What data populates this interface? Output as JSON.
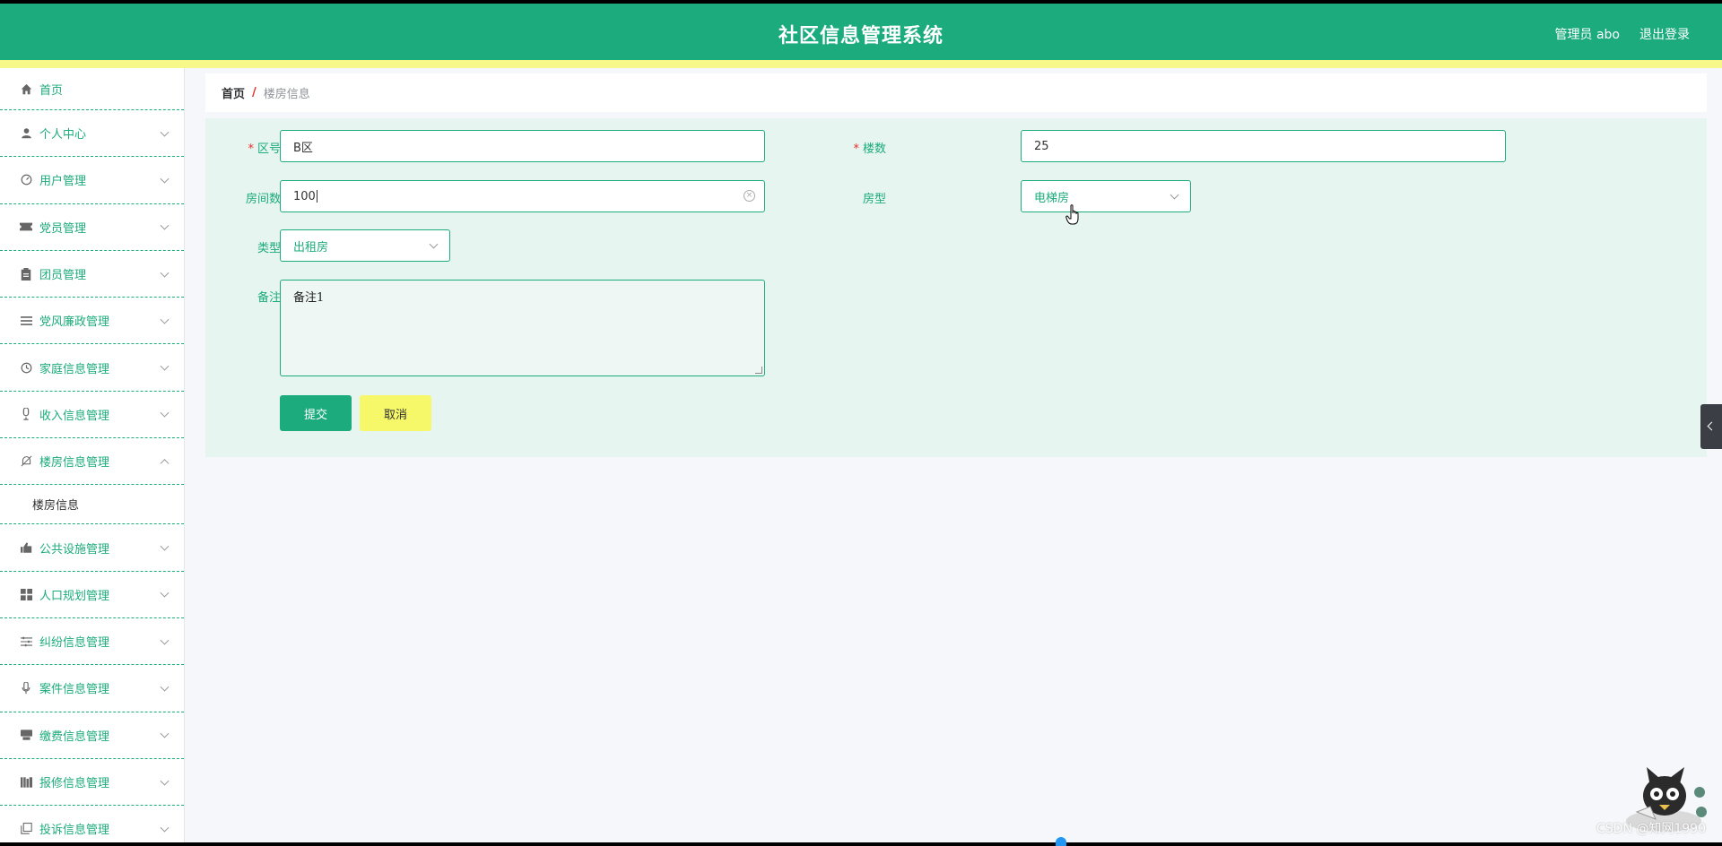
{
  "header": {
    "title": "社区信息管理系统",
    "user_label": "管理员 abo",
    "logout_label": "退出登录"
  },
  "sidebar": {
    "home": {
      "label": "首页",
      "icon": "home-icon"
    },
    "items": [
      {
        "label": "个人中心",
        "icon": "user-icon"
      },
      {
        "label": "用户管理",
        "icon": "dashboard-icon"
      },
      {
        "label": "党员管理",
        "icon": "ticket-icon"
      },
      {
        "label": "团员管理",
        "icon": "clipboard-icon"
      },
      {
        "label": "党风廉政管理",
        "icon": "list-icon"
      },
      {
        "label": "家庭信息管理",
        "icon": "clock-icon"
      },
      {
        "label": "收入信息管理",
        "icon": "mic-icon"
      },
      {
        "label": "楼房信息管理",
        "icon": "bell-off-icon",
        "expanded": true,
        "children": [
          {
            "label": "楼房信息"
          }
        ]
      },
      {
        "label": "公共设施管理",
        "icon": "thumb-icon"
      },
      {
        "label": "人口规划管理",
        "icon": "grid-icon"
      },
      {
        "label": "纠纷信息管理",
        "icon": "sliders-icon"
      },
      {
        "label": "案件信息管理",
        "icon": "microphone-icon"
      },
      {
        "label": "缴费信息管理",
        "icon": "printer-icon"
      },
      {
        "label": "报修信息管理",
        "icon": "books-icon"
      },
      {
        "label": "投诉信息管理",
        "icon": "copy-icon"
      }
    ]
  },
  "breadcrumb": {
    "home": "首页",
    "separator": "/",
    "current": "楼房信息"
  },
  "form": {
    "district": {
      "label": "区号",
      "required": true,
      "value": "B区"
    },
    "floors": {
      "label": "楼数",
      "required": true,
      "value": "25"
    },
    "rooms": {
      "label": "房间数",
      "value": "100"
    },
    "room_type": {
      "label": "房型",
      "value": "电梯房"
    },
    "category": {
      "label": "类型",
      "value": "出租房"
    },
    "remarks": {
      "label": "备注",
      "value": "备注1"
    },
    "submit_label": "提交",
    "cancel_label": "取消"
  },
  "watermark": "CSDN @知网1990",
  "colors": {
    "primary": "#1cab7c",
    "accent_yellow": "#f6f88a",
    "panel_bg": "#e6f5f0",
    "required": "#e62e2e"
  }
}
